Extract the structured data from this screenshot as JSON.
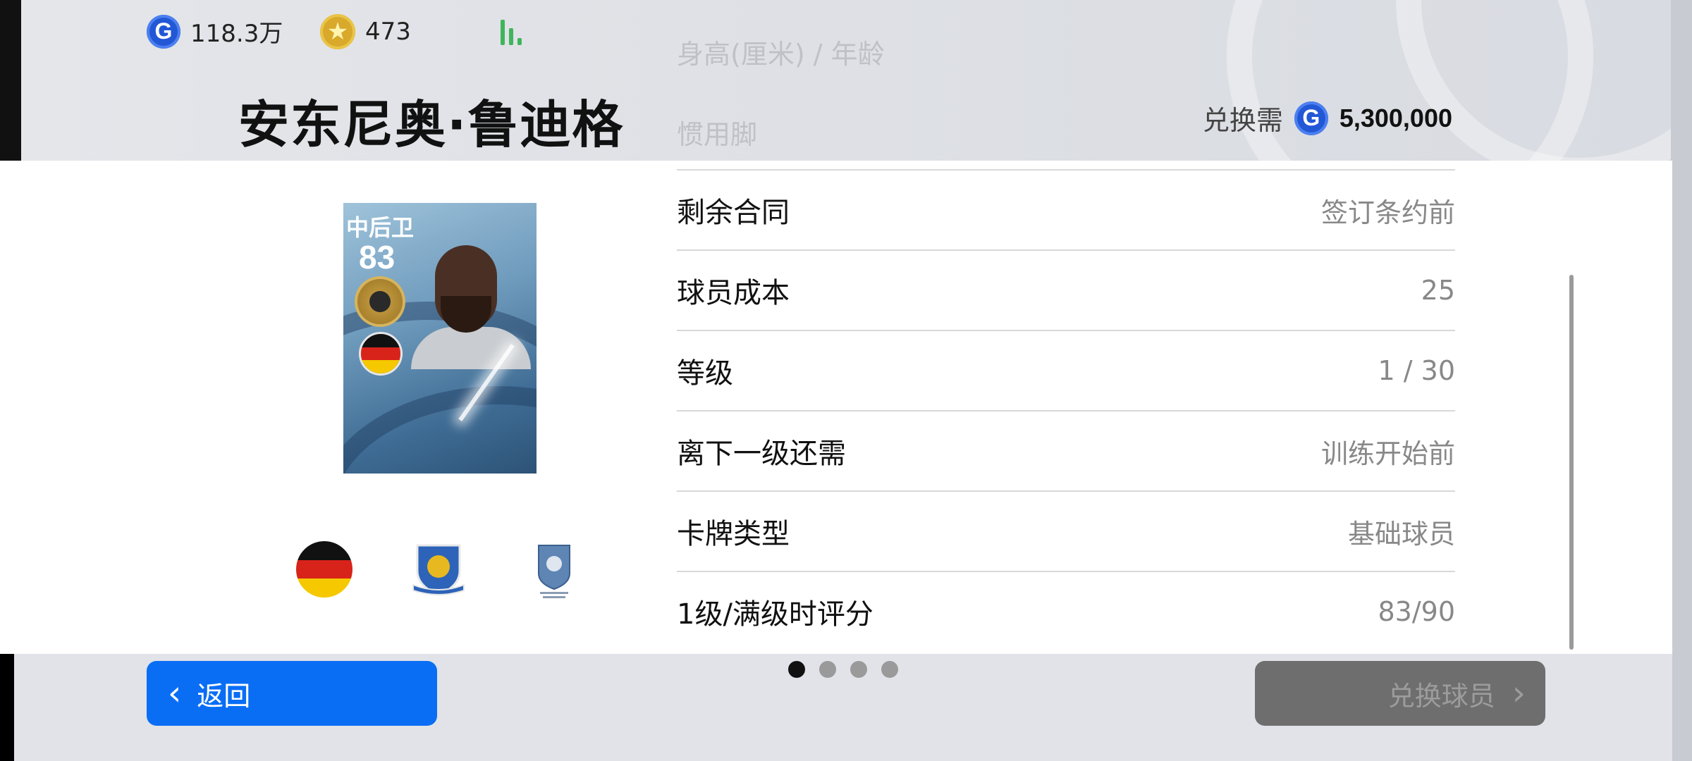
{
  "header": {
    "gp": "118.3万",
    "coins": "473",
    "ghost_rows": [
      "身高(厘米) / 年龄",
      "惯用脚"
    ]
  },
  "player": {
    "name": "安东尼奥·鲁迪格",
    "exchange_label": "兑换需",
    "exchange_cost": "5,300,000",
    "card": {
      "position": "中后卫",
      "rating": "83"
    }
  },
  "stats": [
    {
      "label": "剩余合同",
      "value": "签订条约前"
    },
    {
      "label": "球员成本",
      "value": "25"
    },
    {
      "label": "等级",
      "value": "1 / 30"
    },
    {
      "label": "离下一级还需",
      "value": "训练开始前"
    },
    {
      "label": "卡牌类型",
      "value": "基础球员"
    },
    {
      "label": "1级/满级时评分",
      "value": "83/90"
    }
  ],
  "footer": {
    "back_label": "返回",
    "exchange_label": "兑换球员",
    "page_count": 4,
    "current_page": 1
  },
  "colors": {
    "primary_button": "#0a6ef5",
    "disabled_button": "#6e6e6e",
    "gp_coin": "#2257d6",
    "star_coin": "#d8a92a"
  },
  "icons": [
    "gp-coin-icon",
    "star-coin-icon",
    "signal-icon",
    "chevron-left-icon",
    "chevron-right-icon"
  ]
}
